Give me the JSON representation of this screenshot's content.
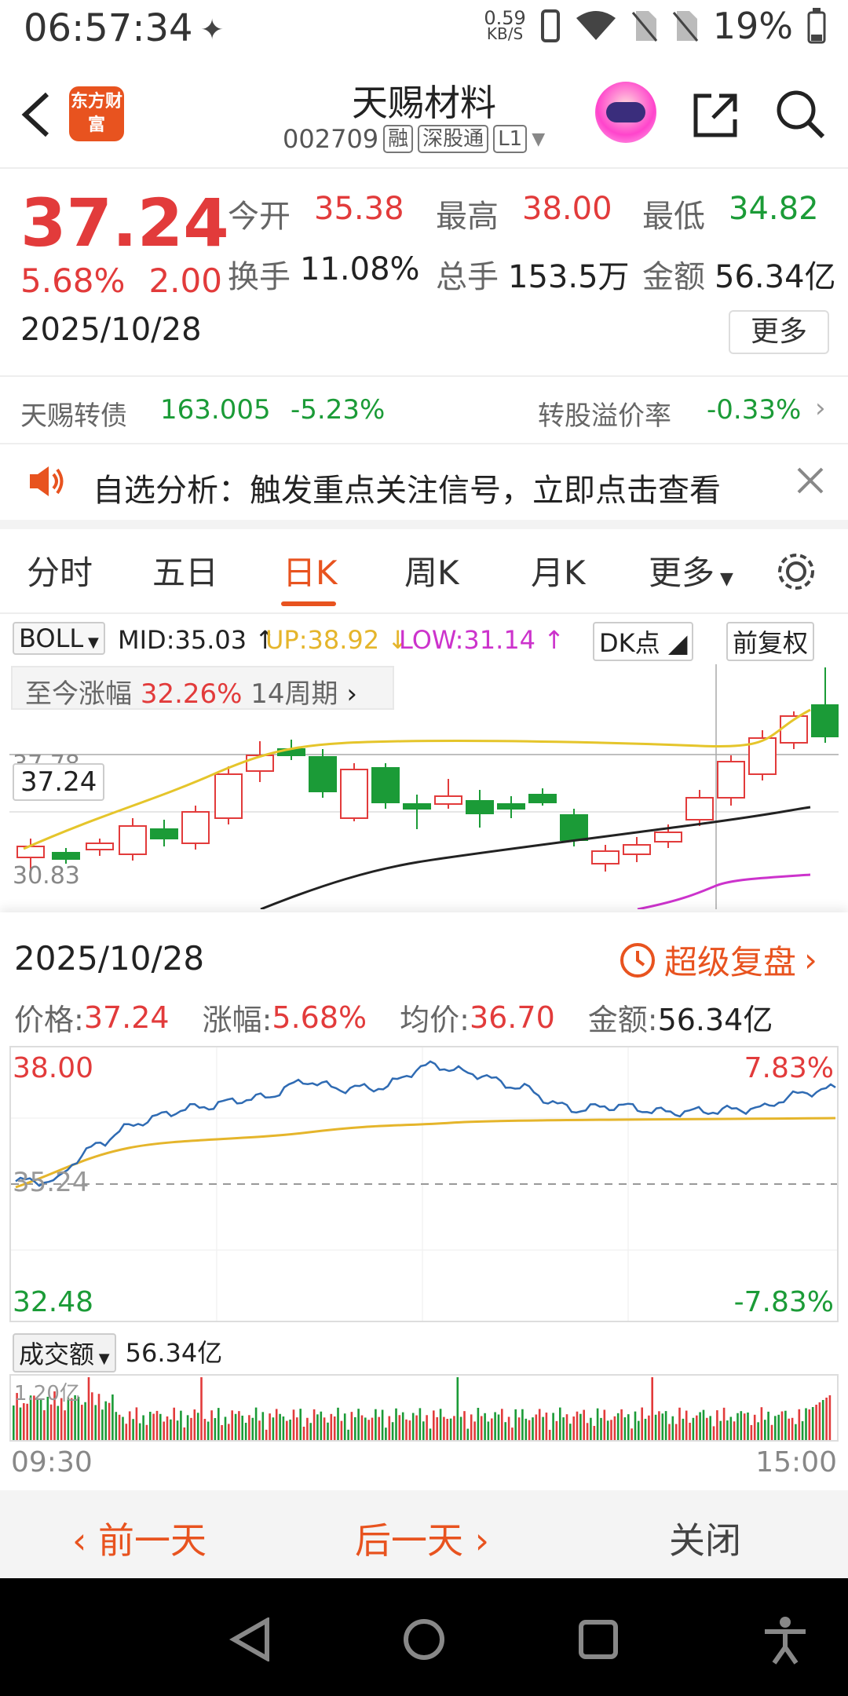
{
  "status_bar": {
    "time": "06:57:34",
    "net_speed_value": "0.59",
    "net_speed_unit": "KB/S",
    "battery": "19%"
  },
  "header": {
    "logo_text": "东方财富",
    "title": "天赐材料",
    "code": "002709",
    "tag_margin": "融",
    "tag_connect": "深股通",
    "tag_level": "L1"
  },
  "quote": {
    "price": "37.24",
    "change_pct": "5.68%",
    "change": "2.00",
    "date": "2025/10/28",
    "open_label": "今开",
    "open": "35.38",
    "high_label": "最高",
    "high": "38.00",
    "low_label": "最低",
    "low": "34.82",
    "turnover_label": "换手",
    "turnover": "11.08%",
    "volume_label": "总手",
    "volume": "153.5万",
    "amount_label": "金额",
    "amount": "56.34亿",
    "more": "更多"
  },
  "bond": {
    "name": "天赐转债",
    "price": "163.005",
    "change": "-5.23%",
    "premium_label": "转股溢价率",
    "premium": "-0.33%"
  },
  "notice": {
    "text": "自选分析：触发重点关注信号，立即点击查看"
  },
  "tabs": {
    "items": [
      "分时",
      "五日",
      "日K",
      "周K",
      "月K",
      "更多"
    ],
    "active": "日K"
  },
  "indicator": {
    "name": "BOLL",
    "mid": "MID:35.03",
    "up": "UP:38.92",
    "low": "LOW:31.14",
    "dk": "DK点",
    "adjust": "前复权"
  },
  "kline": {
    "range_label": "至今涨幅",
    "range_value": "32.26%",
    "period": "14周期",
    "price_tag": "37.24",
    "axis_top": "37.78",
    "axis_low": "30.83"
  },
  "popup": {
    "date": "2025/10/28",
    "replay": "超级复盘",
    "price_label": "价格:",
    "price": "37.24",
    "pct_label": "涨幅:",
    "pct": "5.68%",
    "avg_label": "均价:",
    "avg": "36.70",
    "amount_label": "金额:",
    "amount": "56.34亿",
    "y_top": "38.00",
    "y_mid": "35.24",
    "y_bottom": "32.48",
    "pct_top": "7.83%",
    "pct_bottom": "-7.83%",
    "vol_label": "成交额",
    "vol_value": "56.34亿",
    "vol_max": "1.20亿",
    "t_start": "09:30",
    "t_end": "15:00"
  },
  "bottom": {
    "prev": "前一天",
    "next": "后一天",
    "close": "关闭"
  },
  "colors": {
    "up": "#e23b3b",
    "down": "#1b9b37",
    "accent": "#e8531f",
    "price_line": "#2f6bb3",
    "avg_line": "#e5b52b",
    "boll_up": "#e5c52b",
    "boll_low": "#cc33cc"
  }
}
